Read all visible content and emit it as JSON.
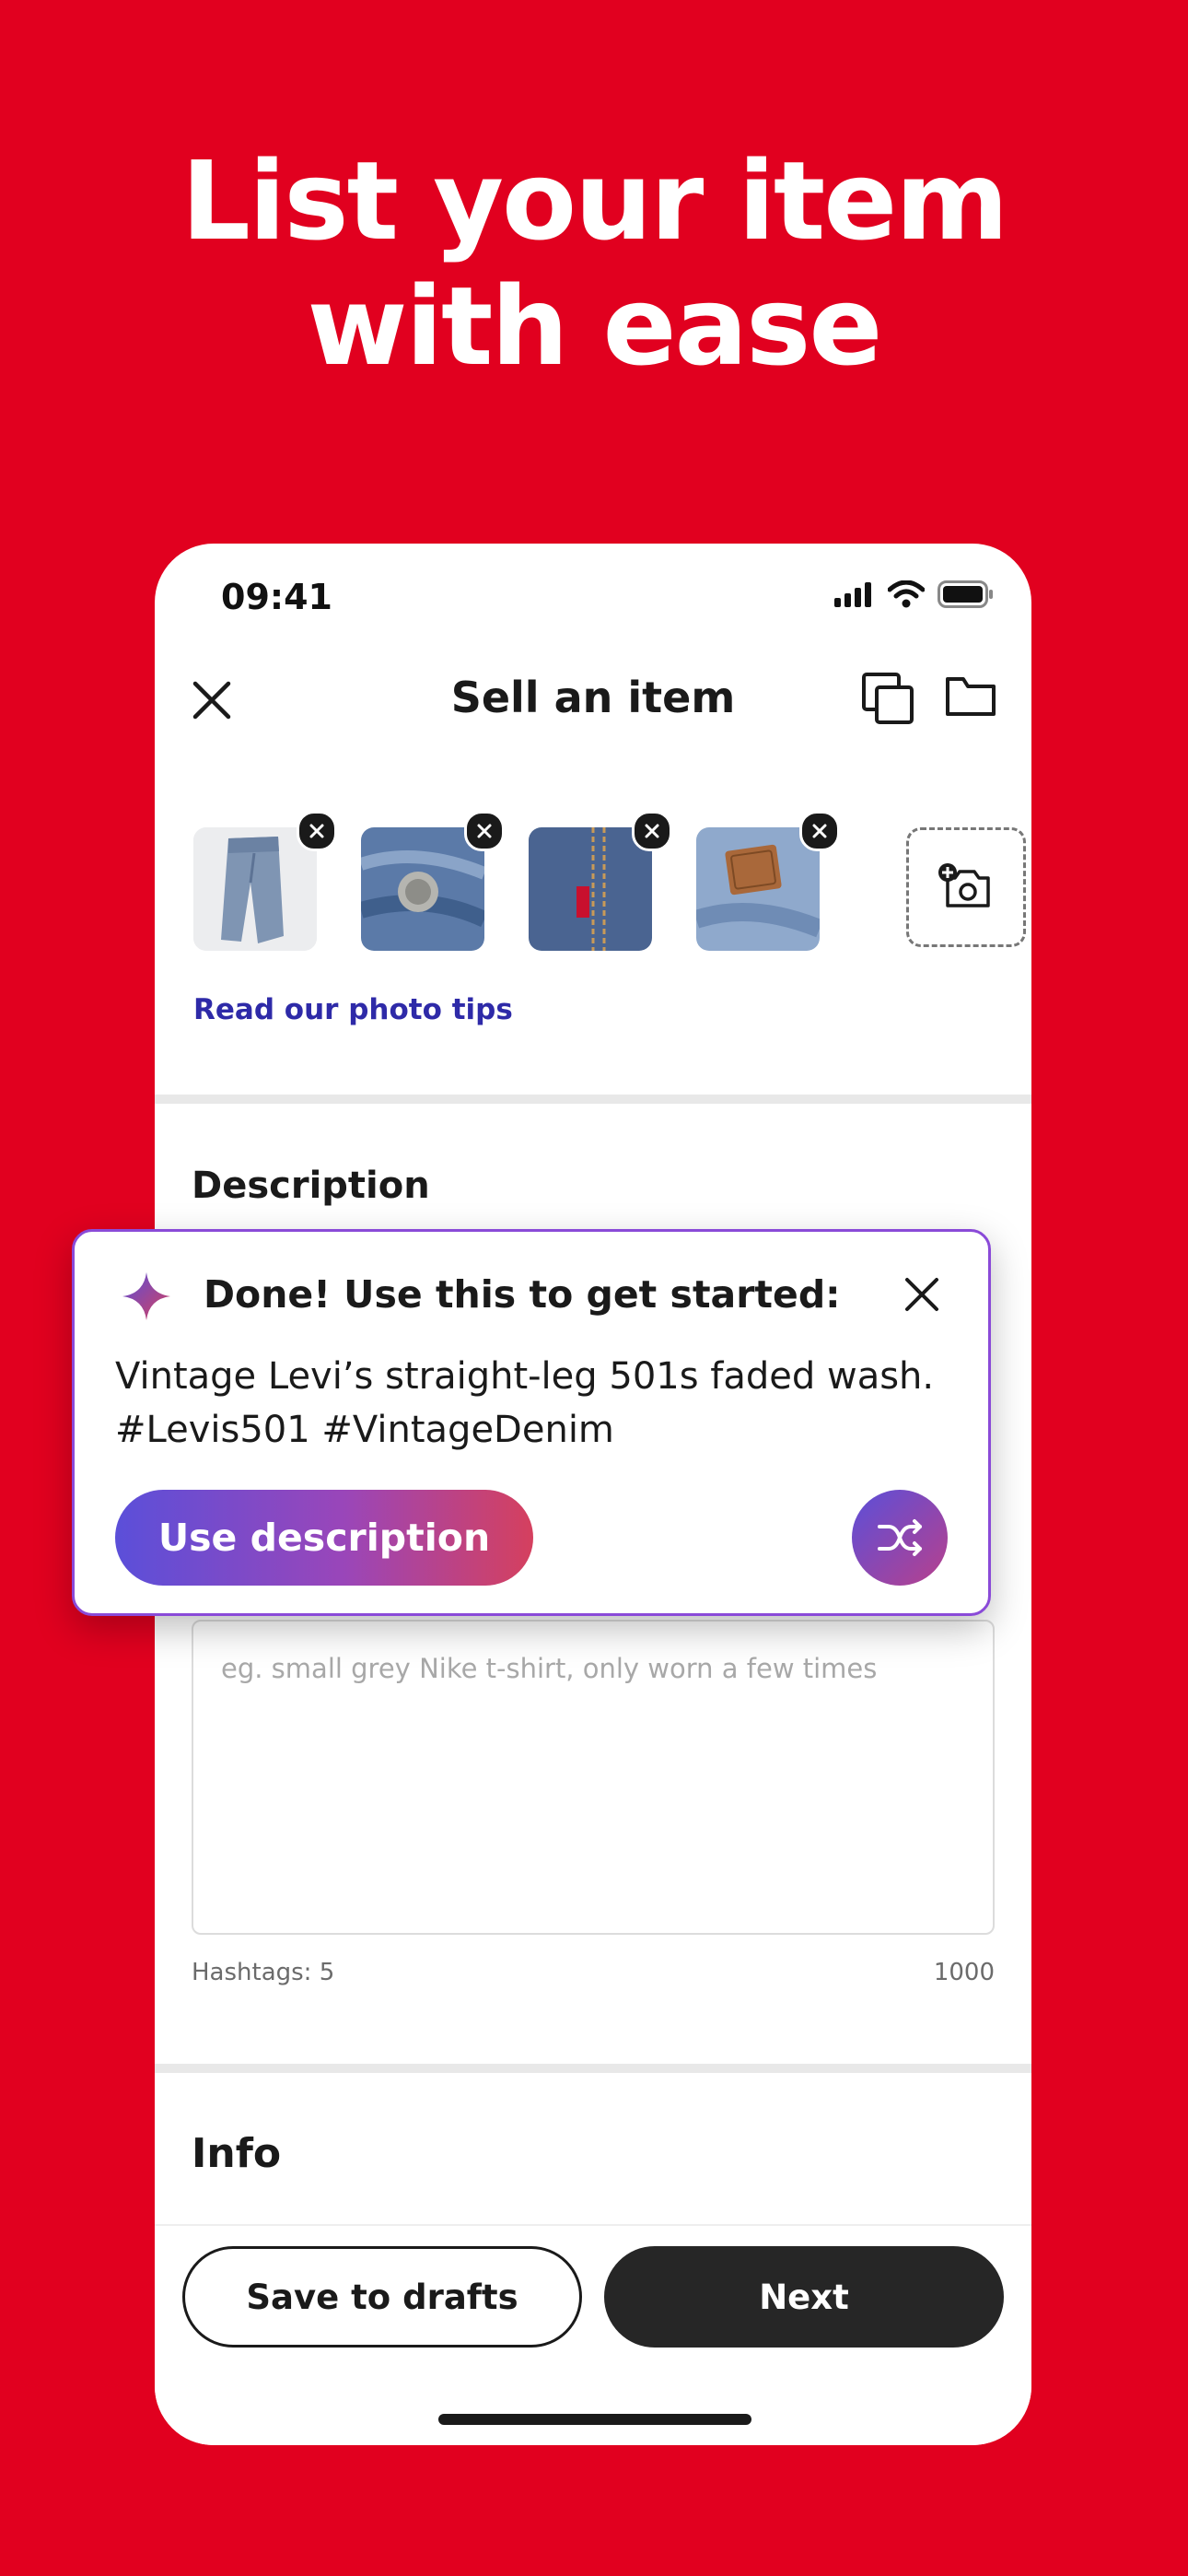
{
  "headline": {
    "line1": "List your item",
    "line2": "with ease"
  },
  "status_bar": {
    "time": "09:41"
  },
  "navbar": {
    "title": "Sell an item"
  },
  "photos": {
    "items": [
      {
        "name": "jeans-folded-photo"
      },
      {
        "name": "jeans-button-photo"
      },
      {
        "name": "jeans-pocket-tab-photo"
      },
      {
        "name": "jeans-leather-patch-photo"
      }
    ],
    "tips_link": "Read our photo tips"
  },
  "description": {
    "title": "Description",
    "placeholder": "eg. small grey Nike t-shirt, only worn a few times",
    "hashtags": "Hashtags: 5",
    "char_count": "1000"
  },
  "ai_suggestion": {
    "title": "Done! Use this to get started:",
    "text": "Vintage Levi’s straight-leg 501s faded wash. #Levis501 #VintageDenim",
    "use_button": "Use description"
  },
  "info": {
    "title": "Info"
  },
  "footer": {
    "save_label": "Save to drafts",
    "next_label": "Next"
  },
  "colors": {
    "brand_red": "#E1001F",
    "link_blue": "#2E2AA8",
    "dark": "#262626",
    "gradient_start": "#5B4FD9",
    "gradient_end": "#D5405E"
  },
  "icons": [
    "close-icon",
    "copy-icon",
    "folder-icon",
    "remove-photo-icon",
    "add-photo-camera-icon",
    "sparkle-icon",
    "shuffle-icon",
    "signal-icon",
    "wifi-icon",
    "battery-icon"
  ]
}
